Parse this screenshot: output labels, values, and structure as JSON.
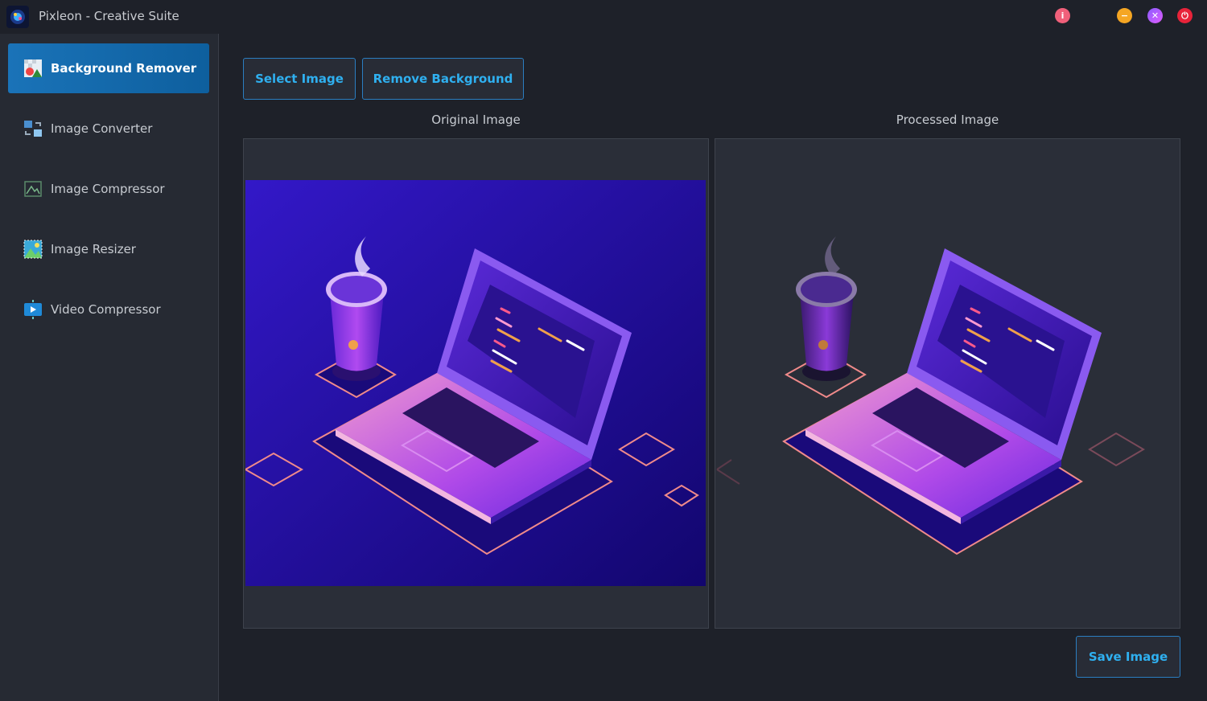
{
  "window": {
    "title": "Pixleon - Creative Suite",
    "controls": {
      "info": "i",
      "minimize": "−",
      "maximize": "✕",
      "close": "⏻"
    }
  },
  "sidebar": {
    "items": [
      {
        "label": "Background Remover",
        "icon": "background-remover-icon",
        "active": true
      },
      {
        "label": "Image Converter",
        "icon": "image-converter-icon",
        "active": false
      },
      {
        "label": "Image Compressor",
        "icon": "image-compressor-icon",
        "active": false
      },
      {
        "label": "Image Resizer",
        "icon": "image-resizer-icon",
        "active": false
      },
      {
        "label": "Video Compressor",
        "icon": "video-compressor-icon",
        "active": false
      }
    ]
  },
  "toolbar": {
    "select_label": "Select Image",
    "remove_label": "Remove Background"
  },
  "panels": {
    "original_label": "Original Image",
    "processed_label": "Processed Image"
  },
  "footer": {
    "save_label": "Save Image"
  },
  "colors": {
    "accent": "#2fb0f0",
    "active_nav": "#1a73b8",
    "image_bg": "#2a1aa8"
  }
}
